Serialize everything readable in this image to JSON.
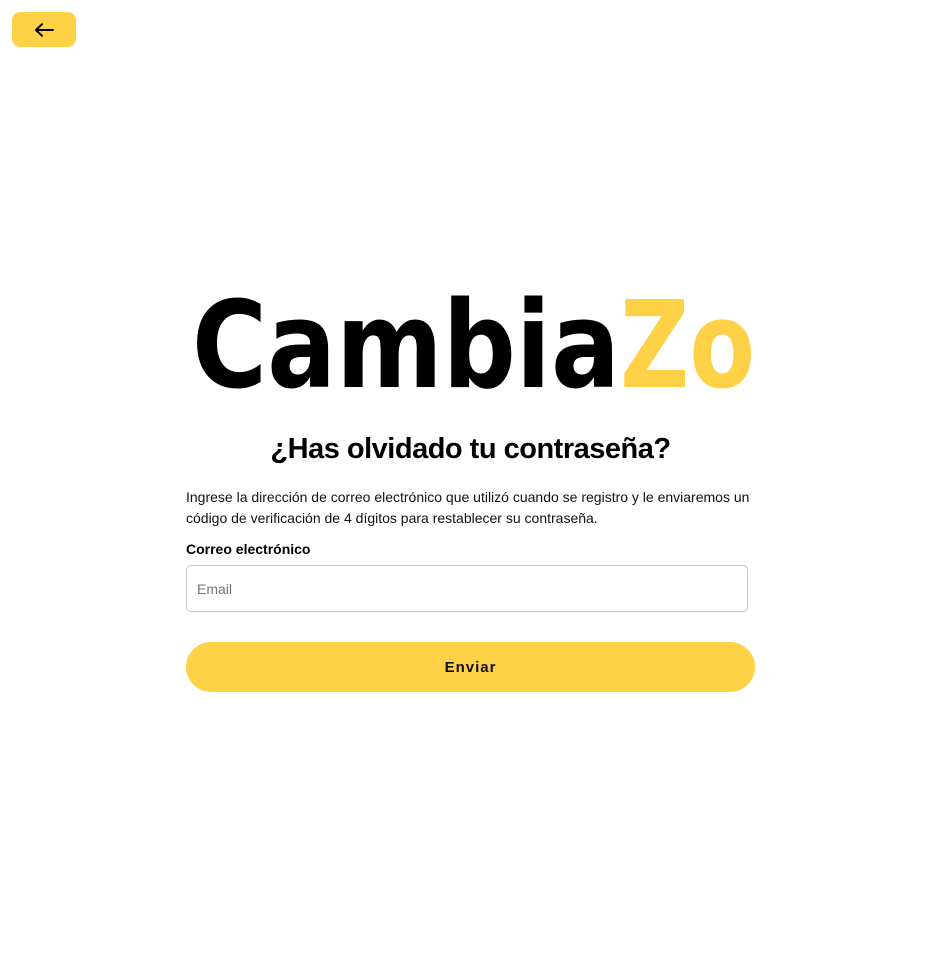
{
  "colors": {
    "accent": "#ffd147",
    "text": "#000000",
    "input_border": "#c6c6c6"
  },
  "header": {
    "back_icon": "arrow-left-icon"
  },
  "logo": {
    "part_dark": "Cambia",
    "part_accent": "Zo"
  },
  "form": {
    "title": "¿Has olvidado tu contraseña?",
    "description": "Ingrese la dirección de correo electrónico que utilizó cuando se registro y le enviaremos un código de verificación de 4 dígitos para restablecer su contraseña.",
    "email_label": "Correo electrónico",
    "email_placeholder": "Email",
    "email_value": "",
    "submit_label": "Enviar"
  }
}
